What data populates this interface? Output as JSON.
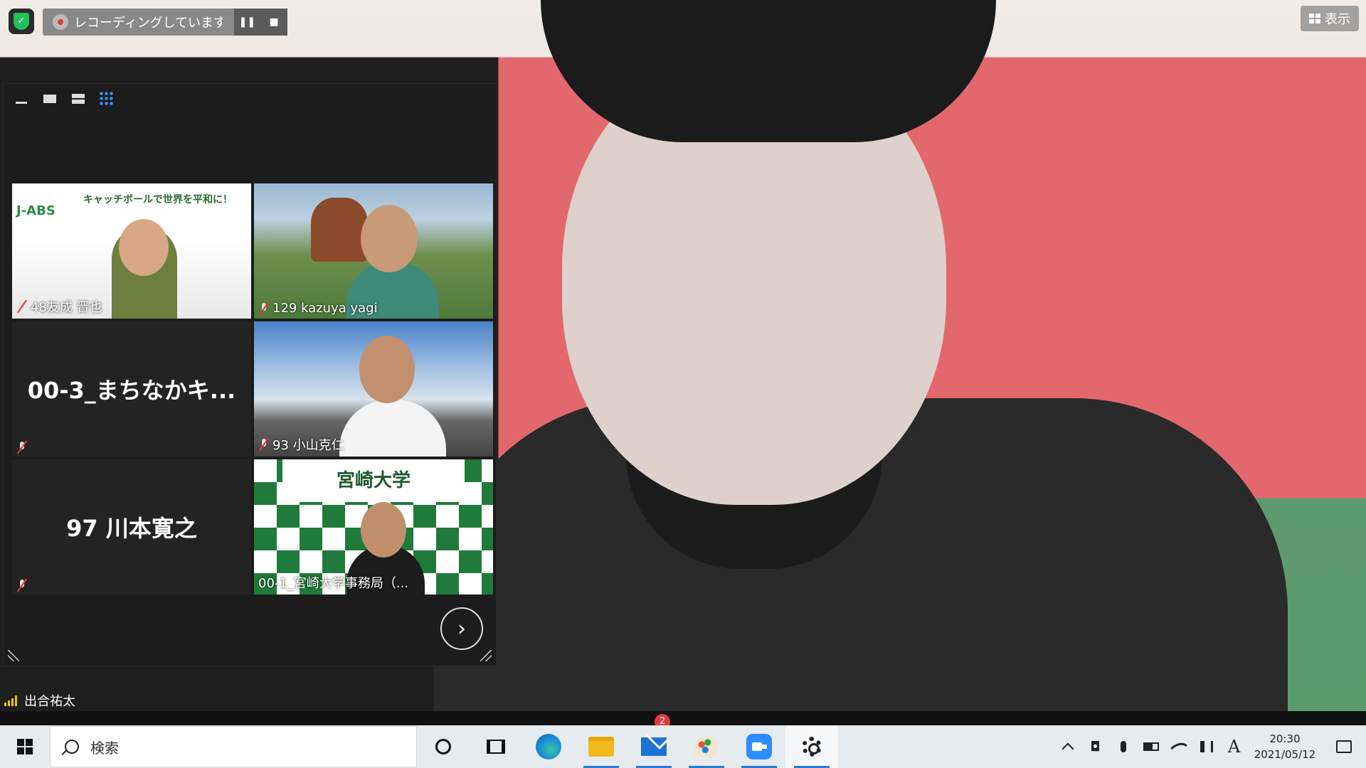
{
  "recording": {
    "status_text": "レコーディングしています...",
    "pause_label": "❚❚",
    "stop_label": "■"
  },
  "view_button": {
    "label": "表示"
  },
  "gallery": {
    "tiles": [
      {
        "name": "48友成 晋也",
        "muted": true,
        "video": true,
        "banner": "キャッチボールで世界を平和に！",
        "logo": "J-ABS"
      },
      {
        "name": "129 kazuya yagi",
        "muted": true,
        "video": true
      },
      {
        "name": "00-3_まちなかキ...",
        "muted": true,
        "video": false
      },
      {
        "name": "93 小山克仁",
        "muted": true,
        "video": true
      },
      {
        "name": "97 川本寛之",
        "muted": true,
        "video": false
      },
      {
        "name": "00-1_宮崎大学事務局（...",
        "muted": false,
        "video": true,
        "backdrop_text": "宮崎大学"
      }
    ],
    "next_label": "›"
  },
  "self_view": {
    "name": "出合祐太"
  },
  "zoom_toolbar": {
    "chat_badge": "2"
  },
  "taskbar": {
    "search_placeholder": "検索",
    "ime_label": "A",
    "time": "20:30",
    "date": "2021/05/12"
  },
  "colors": {
    "accent_blue": "#2d8cff",
    "security_green": "#22c05a",
    "mute_red": "#e5383b",
    "taskbar_bg": "#e6ebef"
  }
}
